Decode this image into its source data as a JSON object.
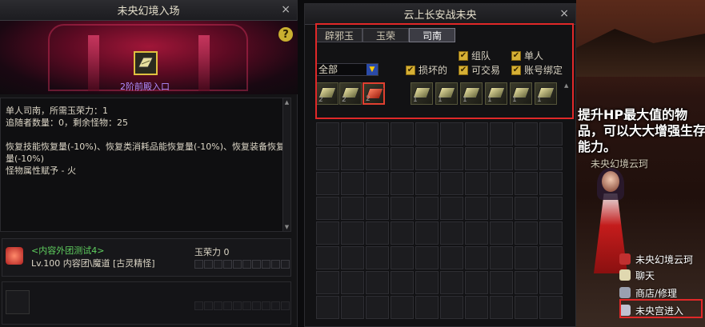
{
  "left_panel": {
    "title": "未央幻境入场",
    "close": "×",
    "help": "?",
    "portal_label": "2阶前殿入口",
    "description": "单人司南，所需玉荣力：1\n追随者数量：0，剩余怪物：25\n\n恢复技能恢复量(-10%)、恢复类消耗品能恢复量(-10%)、恢复装备恢复量(-10%)\n怪物属性赋予 - 火",
    "member": {
      "guild": "<内容外团测试4>",
      "level_info": "Lv.100 内容团\\魔道 [古灵精怪]",
      "points_label": "玉荣力 0"
    }
  },
  "mid_panel": {
    "title": "云上长安战未央",
    "close": "×",
    "tabs": [
      "辟邪玉",
      "玉荣",
      "司南"
    ],
    "active_tab": 2,
    "filter_select": "全部",
    "checkboxes": {
      "broken": "损坏的",
      "party": "组队",
      "tradeable": "可交易",
      "solo": "单人",
      "account_bound": "账号绑定"
    },
    "items": [
      {
        "count": "2"
      },
      {
        "count": "2"
      },
      {
        "count": "2"
      },
      {
        "count": "1"
      },
      {
        "count": "1"
      },
      {
        "count": "1"
      },
      {
        "count": "1"
      },
      {
        "count": "1"
      },
      {
        "count": "1"
      },
      {
        "count": "1"
      }
    ]
  },
  "right_scene": {
    "speech": "提升HP最大值的物品，可以大大增强生存能力。",
    "npc_name": "未央幻境云珂",
    "menu": {
      "npc": "未央幻境云珂",
      "chat": "聊天",
      "shop": "商店/修理",
      "enter": "未央宫进入"
    }
  },
  "colors": {
    "highlight": "#e02828",
    "guild_green": "#5fd05f",
    "checkbox_gold": "#d6b035"
  }
}
